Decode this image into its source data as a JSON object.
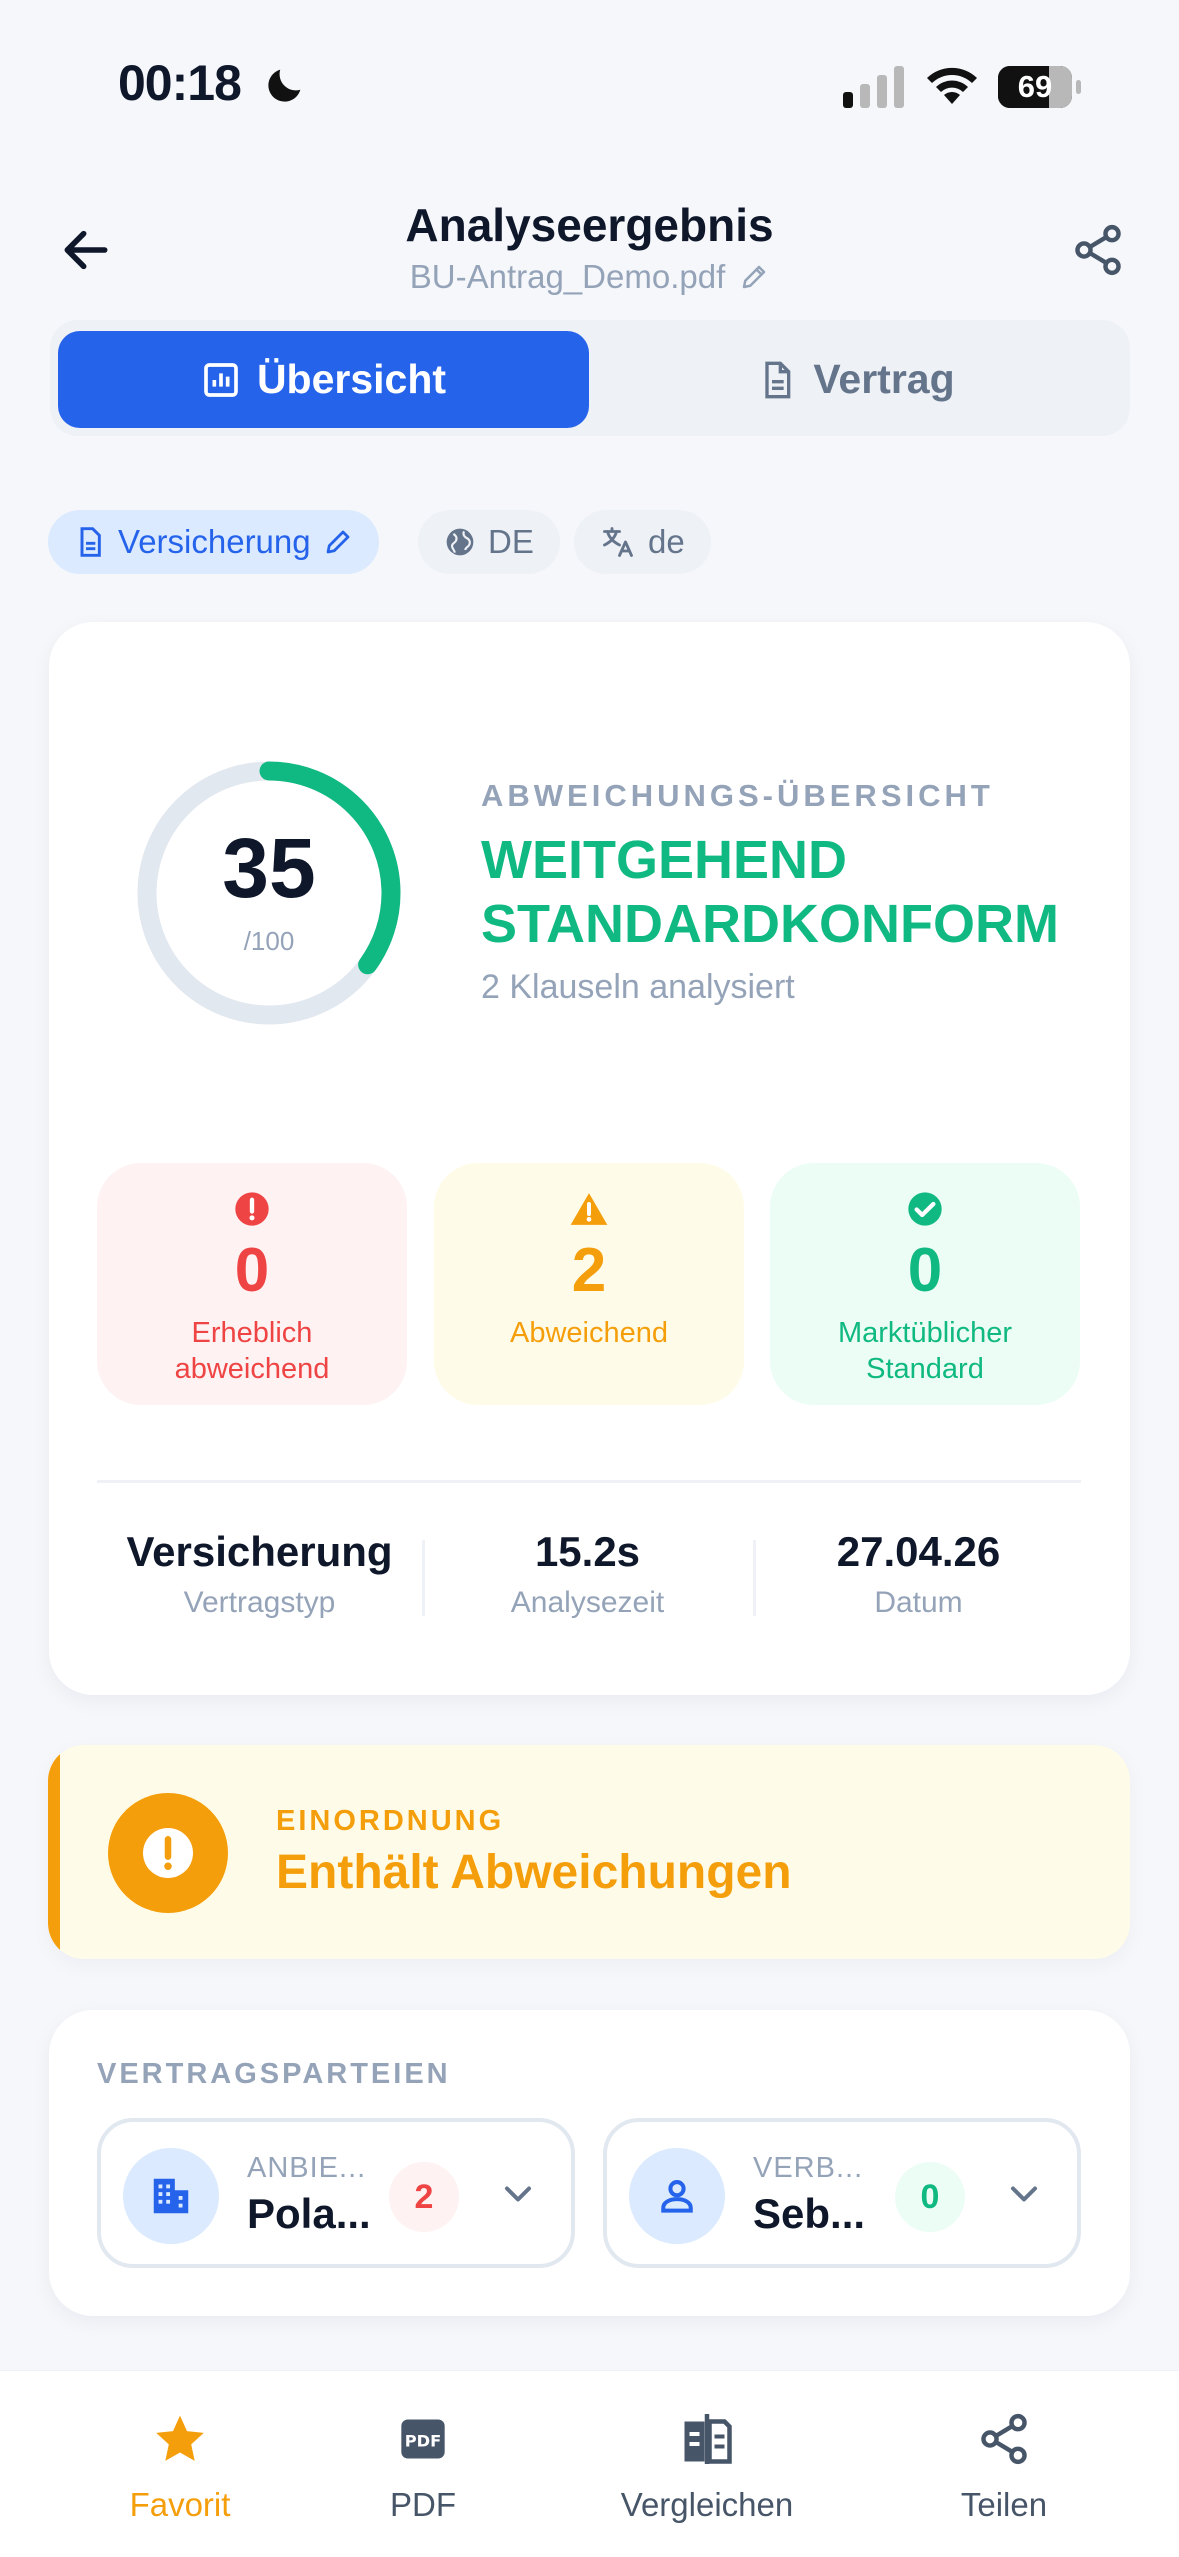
{
  "status_bar": {
    "time": "00:18",
    "battery": "69",
    "battery_level": 0.69
  },
  "header": {
    "title": "Analyseergebnis",
    "file_name": "BU-Antrag_Demo.pdf"
  },
  "tabs": [
    {
      "label": "Übersicht",
      "active": true
    },
    {
      "label": "Vertrag",
      "active": false
    }
  ],
  "chips": {
    "contract_type": "Versicherung",
    "country": "DE",
    "language": "de"
  },
  "overview": {
    "score": "35",
    "score_max": "/100",
    "score_value": 35,
    "section_label": "ABWEICHUNGS-ÜBERSICHT",
    "status_line1": "WEITGEHEND",
    "status_line2": "STANDARDKONFORM",
    "clauses_text": "2 Klauseln analysiert",
    "stats": [
      {
        "count": "0",
        "label_line1": "Erheblich",
        "label_line2": "abweichend"
      },
      {
        "count": "2",
        "label_line1": "Abweichend",
        "label_line2": ""
      },
      {
        "count": "0",
        "label_line1": "Marktüblicher",
        "label_line2": "Standard"
      }
    ],
    "meta": [
      {
        "value": "Versicherung",
        "label": "Vertragstyp"
      },
      {
        "value": "15.2s",
        "label": "Analysezeit"
      },
      {
        "value": "27.04.26",
        "label": "Datum"
      }
    ]
  },
  "classification": {
    "label": "EINORDNUNG",
    "title": "Enthält Abweichungen"
  },
  "parties": {
    "label": "VERTRAGSPARTEIEN",
    "items": [
      {
        "type": "ANBIE...",
        "name": "Pola...",
        "count": "2",
        "icon": "building-icon"
      },
      {
        "type": "VERB...",
        "name": "Seb...",
        "count": "0",
        "icon": "person-icon"
      }
    ]
  },
  "bottom_nav": [
    {
      "label": "Favorit",
      "icon": "star-icon",
      "active": true
    },
    {
      "label": "PDF",
      "icon": "pdf-icon",
      "active": false
    },
    {
      "label": "Vergleichen",
      "icon": "compare-icon",
      "active": false
    },
    {
      "label": "Teilen",
      "icon": "share-icon",
      "active": false
    }
  ],
  "colors": {
    "primary": "#2563EB",
    "success": "#10B981",
    "warning": "#F59E0B",
    "danger": "#EF4444",
    "muted": "#94A3B8",
    "background": "#F5F7FB"
  }
}
